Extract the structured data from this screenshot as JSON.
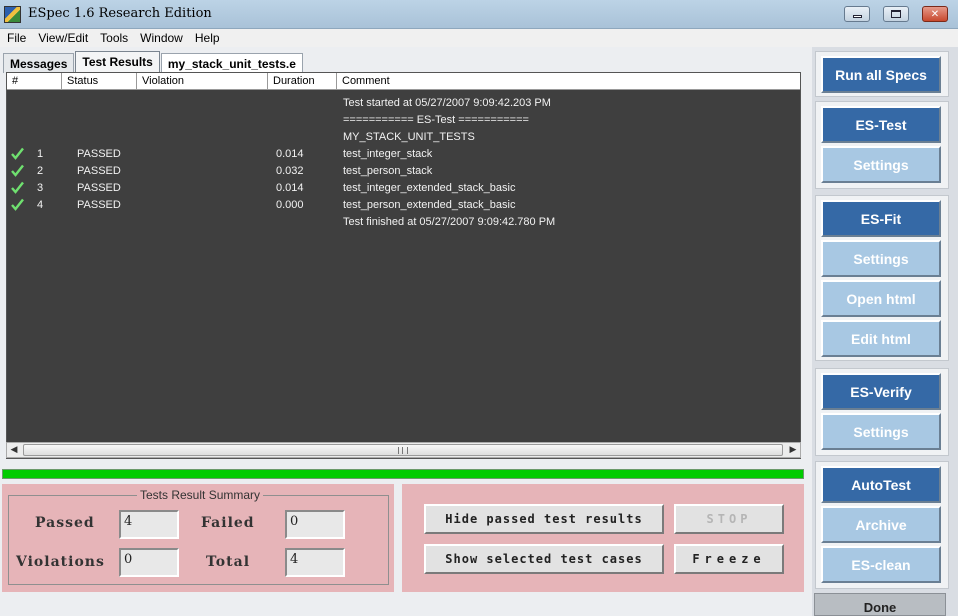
{
  "window": {
    "title": "ESpec 1.6 Research Edition"
  },
  "menu": [
    "File",
    "View/Edit",
    "Tools",
    "Window",
    "Help"
  ],
  "tabs": [
    "Messages",
    "Test Results",
    "my_stack_unit_tests.e"
  ],
  "table": {
    "columns": [
      "#",
      "Status",
      "Violation",
      "Duration",
      "Comment"
    ],
    "rows": [
      {
        "passed": false,
        "num": "",
        "status": "",
        "violation": "",
        "duration": "",
        "comment": "Test started at 05/27/2007 9:09:42.203 PM"
      },
      {
        "passed": false,
        "num": "",
        "status": "",
        "violation": "",
        "duration": "",
        "comment": "=========== ES-Test ==========="
      },
      {
        "passed": false,
        "num": "",
        "status": "",
        "violation": "",
        "duration": "",
        "comment": "MY_STACK_UNIT_TESTS"
      },
      {
        "passed": true,
        "num": "1",
        "status": "PASSED",
        "violation": "",
        "duration": "0.014",
        "comment": "test_integer_stack"
      },
      {
        "passed": true,
        "num": "2",
        "status": "PASSED",
        "violation": "",
        "duration": "0.032",
        "comment": "test_person_stack"
      },
      {
        "passed": true,
        "num": "3",
        "status": "PASSED",
        "violation": "",
        "duration": "0.014",
        "comment": "test_integer_extended_stack_basic"
      },
      {
        "passed": true,
        "num": "4",
        "status": "PASSED",
        "violation": "",
        "duration": "0.000",
        "comment": "test_person_extended_stack_basic"
      },
      {
        "passed": false,
        "num": "",
        "status": "",
        "violation": "",
        "duration": "",
        "comment": "Test finished at 05/27/2007 9:09:42.780 PM"
      }
    ]
  },
  "progress": {
    "fraction": 1.0,
    "color": "#00cc00"
  },
  "summary": {
    "title": "Tests Result Summary",
    "passed_label": "Passed",
    "passed": "4",
    "failed_label": "Failed",
    "failed": "0",
    "violations_label": "Violations",
    "violations": "0",
    "total_label": "Total",
    "total": "4"
  },
  "actions": {
    "hide_passed": "Hide passed test results",
    "show_selected": "Show selected test cases",
    "stop": "STOP",
    "freeze": "Freeze"
  },
  "sidebar": {
    "run_all": "Run all Specs",
    "es_test": "ES-Test",
    "es_test_settings": "Settings",
    "es_fit": "ES-Fit",
    "es_fit_settings": "Settings",
    "open_html": "Open html",
    "edit_html": "Edit html",
    "es_verify": "ES-Verify",
    "es_verify_settings": "Settings",
    "autotest": "AutoTest",
    "archive": "Archive",
    "es_clean": "ES-clean",
    "done": "Done"
  },
  "colors": {
    "accent": "#3569a6",
    "accent_light": "#a8c8e3",
    "panel": "#e6b4b8",
    "results_bg": "#3f3f3f"
  }
}
